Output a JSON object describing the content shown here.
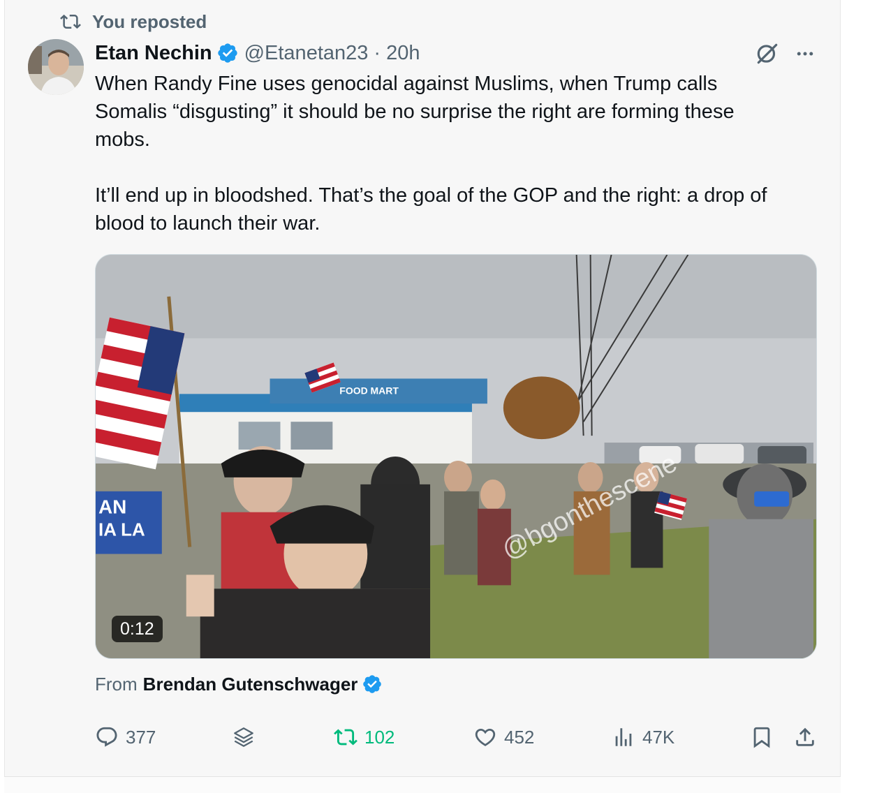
{
  "repost_header": {
    "label": "You reposted",
    "icon": "repost-icon"
  },
  "author": {
    "display_name": "Etan Nechin",
    "handle": "@Etanetan23",
    "separator": "·",
    "timestamp": "20h",
    "verified": true
  },
  "tweet": {
    "text": "When Randy Fine uses genocidal against Muslims, when Trump calls\nSomalis “disgusting” it should be no surprise the right are forming these\nmobs.\n\nIt’ll end up in bloodshed. That’s the goal of the GOP and the right: a drop of\nblood to launch their war."
  },
  "media": {
    "duration": "0:12",
    "watermark": "@bgonthescene",
    "signs": {
      "store": "FOOD MART",
      "banner_line1": "AN",
      "banner_line2": "IA LA"
    }
  },
  "source": {
    "prefix": "From",
    "name": "Brendan Gutenschwager",
    "verified": true
  },
  "actions": {
    "replies": {
      "icon": "reply-icon",
      "count": "377"
    },
    "grok": {
      "icon": "layers-icon"
    },
    "reposts": {
      "icon": "repost-icon",
      "count": "102",
      "active": true
    },
    "likes": {
      "icon": "heart-icon",
      "count": "452"
    },
    "views": {
      "icon": "views-icon",
      "count": "47K"
    },
    "bookmark": {
      "icon": "bookmark-icon"
    },
    "share": {
      "icon": "share-icon"
    }
  },
  "colors": {
    "verified_blue": "#1d9bf0",
    "repost_green": "#00ba7c",
    "secondary_text": "#536471",
    "primary_text": "#0f1419"
  }
}
